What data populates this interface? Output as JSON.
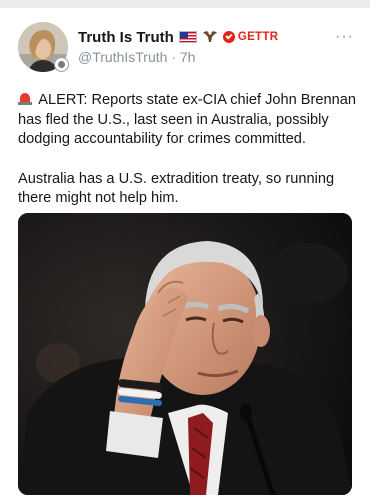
{
  "post": {
    "author": {
      "display_name": "Truth Is Truth",
      "emojis": [
        "flag-us-icon",
        "eagle-icon"
      ],
      "platform_badge": "GETTR",
      "handle": "@TruthIsTruth",
      "separator": "·",
      "time": "7h"
    },
    "more_label": "···",
    "paragraphs": [
      "ALERT:  Reports state ex-CIA chief John Brennan has fled the U.S., last seen in Australia, possibly dodging accountability for crimes committed.",
      "Australia has a U.S. extradition treaty, so running there might not help him."
    ],
    "alert_icon": "siren-icon",
    "image": {
      "subject": "photo-of-man-hand-on-forehead"
    }
  },
  "colors": {
    "text": "#14171a",
    "muted": "#8a9299",
    "gettr_red": "#e2231a",
    "background": "#ffffff"
  }
}
